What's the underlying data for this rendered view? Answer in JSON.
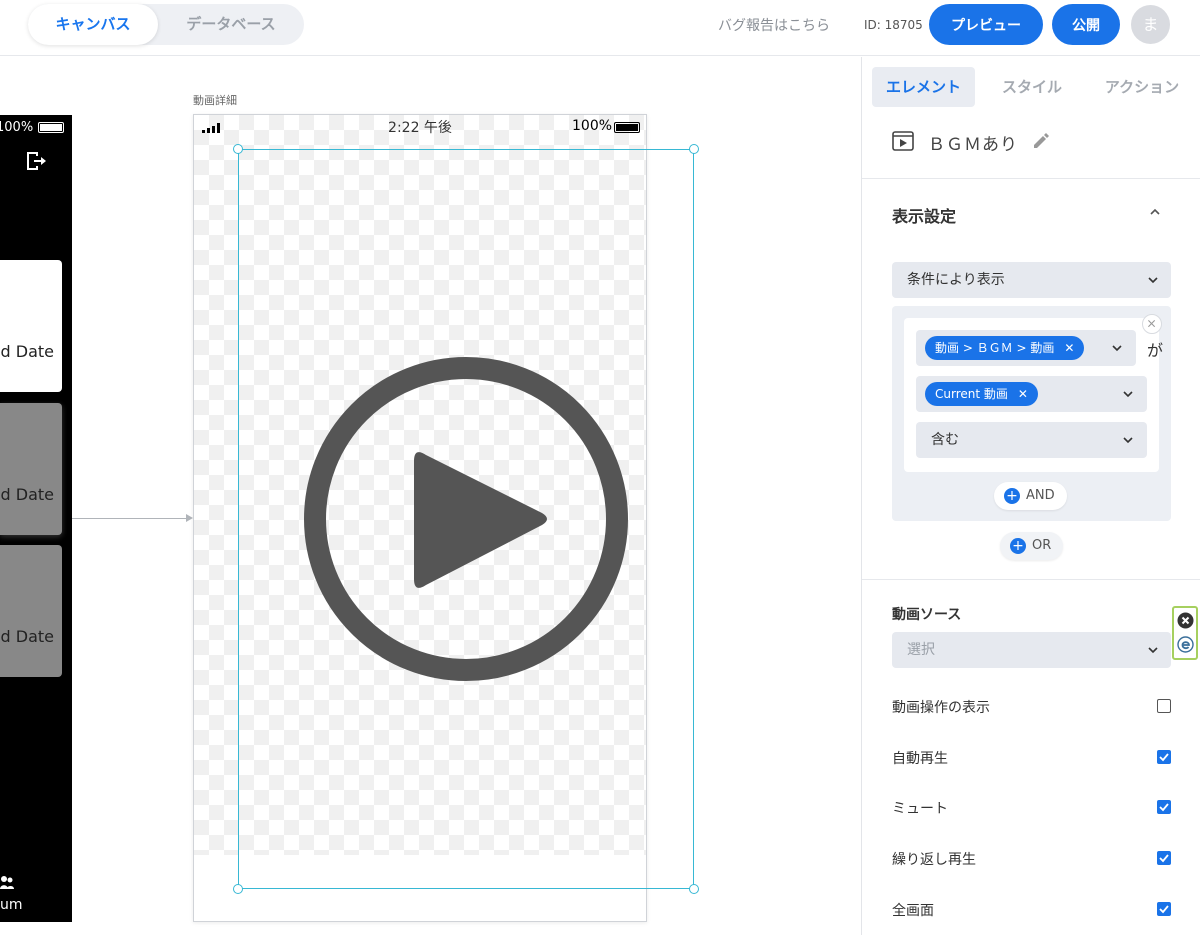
{
  "topbar": {
    "tabs": [
      {
        "label": "キャンバス",
        "active": true
      },
      {
        "label": "データベース",
        "active": false
      }
    ],
    "bug_report": "バグ報告はこちら",
    "project_id": "ID: 18705",
    "preview_label": "プレビュー",
    "publish_label": "公開",
    "avatar_initial": "ま"
  },
  "canvas": {
    "left_phone": {
      "battery_text": "100%",
      "cards": [
        {
          "text": "ed Date"
        },
        {
          "text": "ed Date"
        },
        {
          "text": "ed Date"
        }
      ],
      "nav_label": "um"
    },
    "screen_label": "動画詳細",
    "main_phone": {
      "time": "2:22 午後",
      "battery_text": "100%"
    }
  },
  "panel": {
    "tabs": [
      {
        "label": "エレメント",
        "active": true
      },
      {
        "label": "スタイル",
        "active": false
      },
      {
        "label": "アクション",
        "active": false
      }
    ],
    "element_name": "ＢＧＭあり",
    "display_section": {
      "title": "表示設定",
      "visibility_select": "条件により表示",
      "condition": {
        "left_chip": "動画 > ＢＧＭ > 動画",
        "connector": "が",
        "right_chip": "Current 動画",
        "operator": "含む"
      },
      "and_label": "AND",
      "or_label": "OR"
    },
    "video_source_label": "動画ソース",
    "video_source_placeholder": "選択",
    "options": [
      {
        "label": "動画操作の表示",
        "checked": false
      },
      {
        "label": "自動再生",
        "checked": true
      },
      {
        "label": "ミュート",
        "checked": true
      },
      {
        "label": "繰り返し再生",
        "checked": true
      },
      {
        "label": "全画面",
        "checked": true
      }
    ]
  },
  "colors": {
    "accent": "#1a73e8",
    "selection": "#37b8d4",
    "widget_border": "#a6d05f"
  }
}
